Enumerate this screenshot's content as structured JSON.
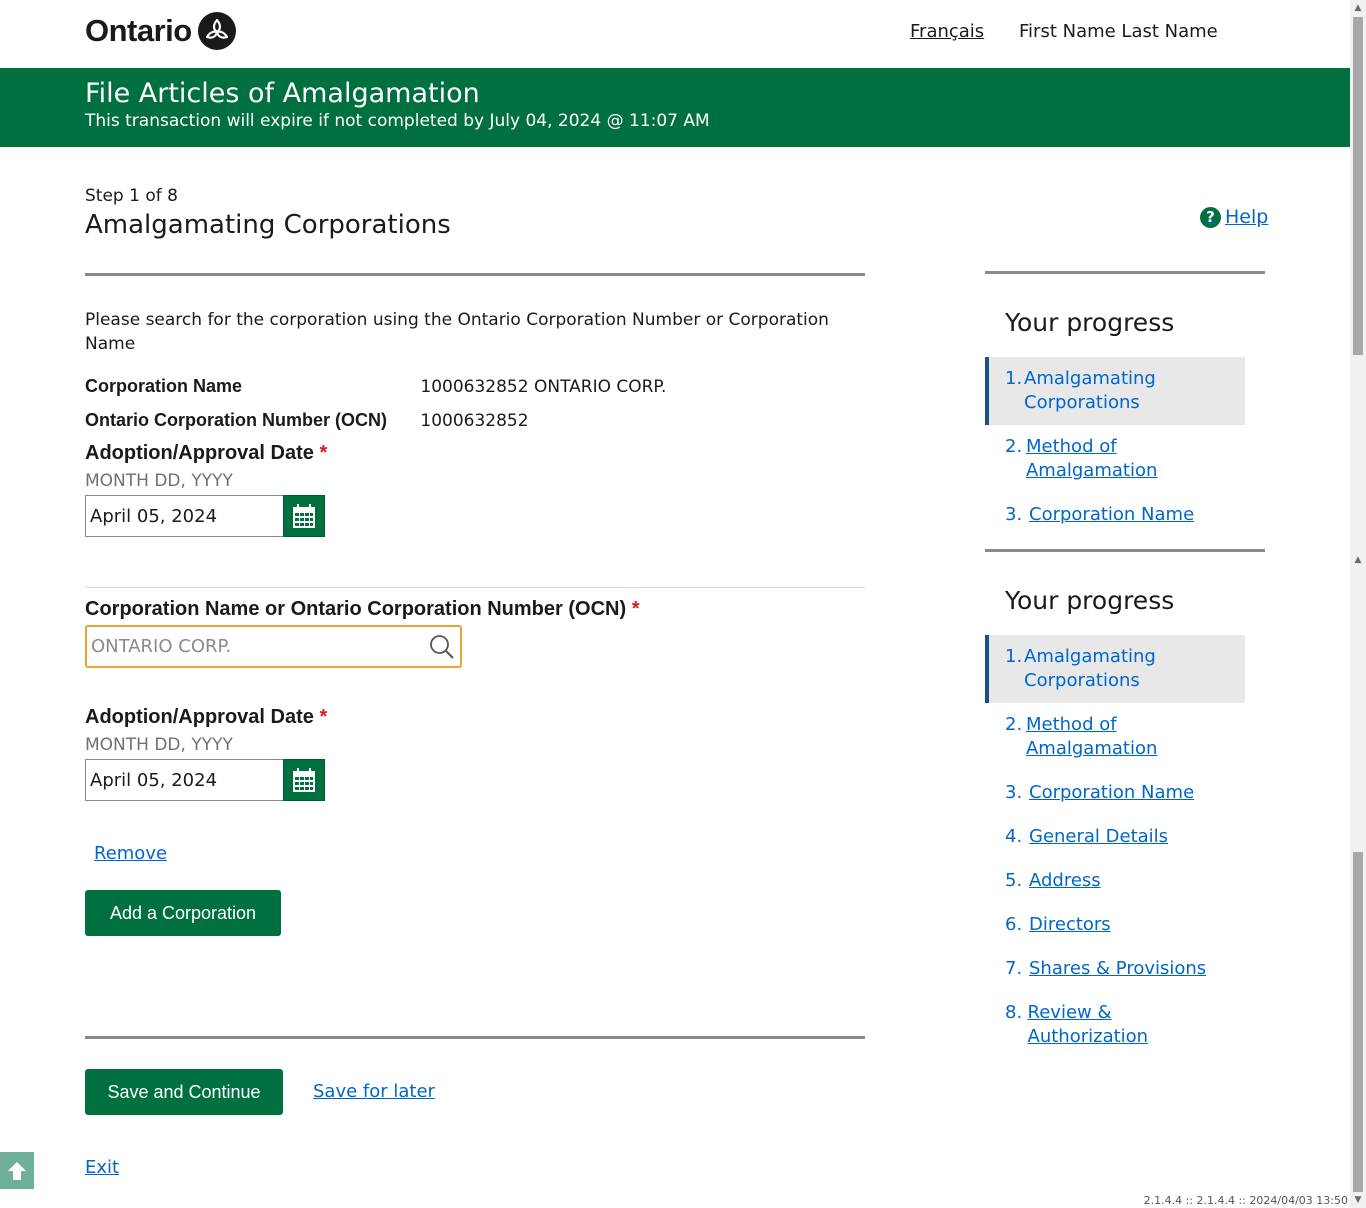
{
  "header": {
    "logo_text": "Ontario",
    "lang_link": "Français",
    "user_name": "First Name Last Name"
  },
  "banner": {
    "title": "File Articles of Amalgamation",
    "expiry": "This transaction will expire if not completed by July 04, 2024 @ 11:07 AM"
  },
  "page": {
    "step": "Step 1 of 8",
    "title": "Amalgamating Corporations",
    "help": "Help",
    "intro": "Please search for the corporation using the Ontario Corporation Number or Corporation Name"
  },
  "corporation": {
    "name_label": "Corporation Name",
    "name_value": "1000632852 ONTARIO CORP.",
    "ocn_label": "Ontario Corporation Number (OCN)",
    "ocn_value": "1000632852"
  },
  "date1": {
    "label": "Adoption/Approval Date",
    "required": "*",
    "hint": "MONTH DD, YYYY",
    "value": "April 05, 2024"
  },
  "search": {
    "label": "Corporation Name or Ontario Corporation Number (OCN)",
    "required": "*",
    "placeholder": "ONTARIO CORP."
  },
  "date2": {
    "label": "Adoption/Approval Date",
    "required": "*",
    "hint": "MONTH DD, YYYY",
    "value": "April 05, 2024"
  },
  "actions": {
    "remove": "Remove",
    "add": "Add a Corporation",
    "save_continue": "Save and Continue",
    "save_later": "Save for later",
    "exit": "Exit"
  },
  "progress1": {
    "title": "Your progress",
    "items": [
      {
        "num": "1.",
        "label": "Amalgamating Corporations"
      },
      {
        "num": "2.",
        "label": "Method of Amalgamation"
      },
      {
        "num": "3.",
        "label": "Corporation Name"
      }
    ]
  },
  "progress2": {
    "title": "Your progress",
    "items": [
      {
        "num": "1.",
        "label": "Amalgamating Corporations"
      },
      {
        "num": "2.",
        "label": "Method of Amalgamation"
      },
      {
        "num": "3.",
        "label": "Corporation Name"
      },
      {
        "num": "4.",
        "label": "General Details"
      },
      {
        "num": "5.",
        "label": "Address"
      },
      {
        "num": "6.",
        "label": "Directors"
      },
      {
        "num": "7.",
        "label": "Shares & Provisions"
      },
      {
        "num": "8.",
        "label": "Review & Authorization"
      }
    ]
  },
  "footer": {
    "version": "2.1.4.4 :: 2.1.4.4 :: 2024/04/03 13:50"
  },
  "colors": {
    "brand_green": "#007041",
    "link_blue": "#0066cc",
    "focus_orange": "#f0a033",
    "required_red": "#d81a21"
  }
}
